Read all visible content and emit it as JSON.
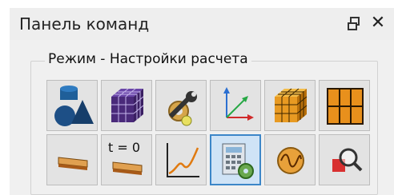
{
  "window": {
    "title": "Панель команд",
    "pin_icon": "pin-icon",
    "close_glyph": "✕"
  },
  "group": {
    "label": "Режим - Настройки расчета"
  },
  "toolbar": {
    "rows": [
      [
        {
          "name": "geometry-button",
          "icon": "geometry-shapes-icon"
        },
        {
          "name": "mesh-cube-button",
          "icon": "purple-mesh-cube-icon"
        },
        {
          "name": "tools-settings-button",
          "icon": "wrench-gear-icon"
        },
        {
          "name": "coordinate-system-button",
          "icon": "xyz-axes-icon"
        },
        {
          "name": "hex-mesh-button",
          "icon": "orange-mesh-cube-icon"
        },
        {
          "name": "grid-plane-button",
          "icon": "orange-grid-icon"
        }
      ],
      [
        {
          "name": "beam-element-button",
          "icon": "beam-icon"
        },
        {
          "name": "initial-condition-button",
          "icon": "beam-t0-icon",
          "text": "t = 0"
        },
        {
          "name": "graph-button",
          "icon": "graph-curve-icon"
        },
        {
          "name": "calculation-settings-button",
          "icon": "calculator-gear-icon",
          "selected": true
        },
        {
          "name": "signal-button",
          "icon": "sine-wave-icon"
        },
        {
          "name": "zoom-inspect-button",
          "icon": "magnifier-icon"
        }
      ]
    ]
  },
  "colors": {
    "accent_selected_border": "#3c86c8",
    "accent_selected_fill": "#cfe3f6",
    "button_fill": "#e3e3e3"
  }
}
